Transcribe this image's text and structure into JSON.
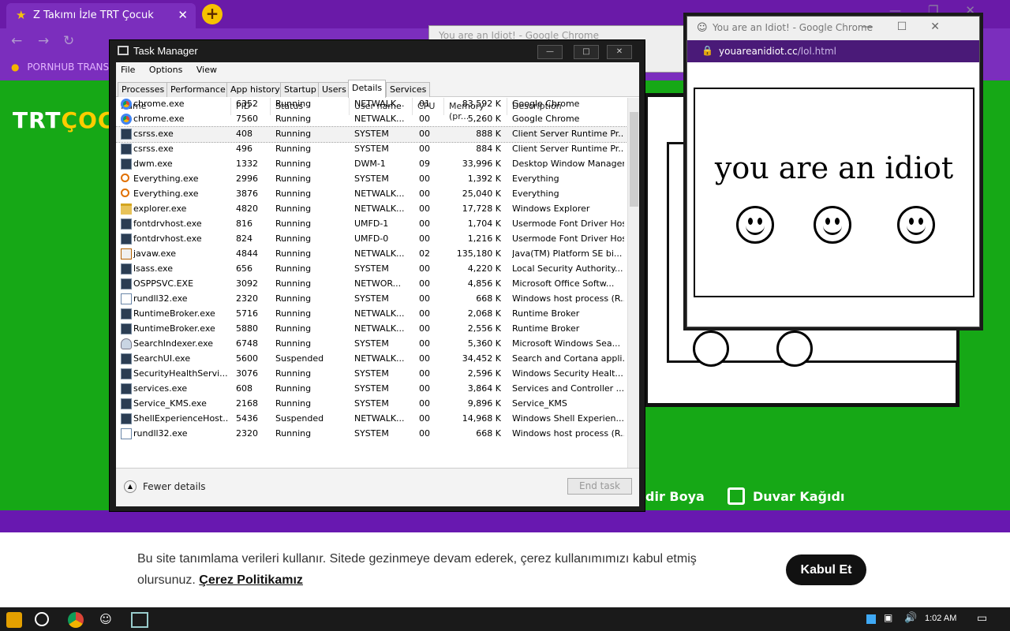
{
  "browser": {
    "tab_title": "Z Takımı İzle TRT Çocuk",
    "bookmark": "PORNHUB TRANS"
  },
  "site": {
    "logo_a": "TRT",
    "logo_b": "ÇOCU",
    "nav_boya": "dir Boya",
    "nav_duvar": "Duvar Kağıdı",
    "cookie_text": "Bu site tanımlama verileri kullanır. Sitede gezinmeye devam ederek, çerez kullanımımızı kabul etmiş olursunuz.",
    "cookie_link": "Çerez Politikamız",
    "accept_label": "Kabul Et"
  },
  "idiot": {
    "window_title": "You are an Idiot! - Google Chrome",
    "url_host": "youareanidiot.cc",
    "url_path": "/lol.html",
    "heading": "you are an idiot"
  },
  "taskmanager": {
    "title": "Task Manager",
    "menu": [
      "File",
      "Options",
      "View"
    ],
    "tabs": [
      "Processes",
      "Performance",
      "App history",
      "Startup",
      "Users",
      "Details",
      "Services"
    ],
    "active_tab": "Details",
    "columns": [
      "Name",
      "PID",
      "Status",
      "User name",
      "CPU",
      "Memory (pr...",
      "Description"
    ],
    "rows": [
      {
        "icon": "chrome",
        "name": "chrome.exe",
        "pid": "6352",
        "status": "Running",
        "user": "NETWALK...",
        "cpu": "01",
        "mem": "83,592 K",
        "desc": "Google Chrome"
      },
      {
        "icon": "chrome",
        "name": "chrome.exe",
        "pid": "7560",
        "status": "Running",
        "user": "NETWALK...",
        "cpu": "00",
        "mem": "5,260 K",
        "desc": "Google Chrome"
      },
      {
        "icon": "win",
        "name": "csrss.exe",
        "pid": "408",
        "status": "Running",
        "user": "SYSTEM",
        "cpu": "00",
        "mem": "888 K",
        "desc": "Client Server Runtime Pr..."
      },
      {
        "icon": "win",
        "name": "csrss.exe",
        "pid": "496",
        "status": "Running",
        "user": "SYSTEM",
        "cpu": "00",
        "mem": "884 K",
        "desc": "Client Server Runtime Pr..."
      },
      {
        "icon": "win",
        "name": "dwm.exe",
        "pid": "1332",
        "status": "Running",
        "user": "DWM-1",
        "cpu": "09",
        "mem": "33,996 K",
        "desc": "Desktop Window Manager"
      },
      {
        "icon": "search",
        "name": "Everything.exe",
        "pid": "2996",
        "status": "Running",
        "user": "SYSTEM",
        "cpu": "00",
        "mem": "1,392 K",
        "desc": "Everything"
      },
      {
        "icon": "search",
        "name": "Everything.exe",
        "pid": "3876",
        "status": "Running",
        "user": "NETWALK...",
        "cpu": "00",
        "mem": "25,040 K",
        "desc": "Everything"
      },
      {
        "icon": "folder",
        "name": "explorer.exe",
        "pid": "4820",
        "status": "Running",
        "user": "NETWALK...",
        "cpu": "00",
        "mem": "17,728 K",
        "desc": "Windows Explorer"
      },
      {
        "icon": "win",
        "name": "fontdrvhost.exe",
        "pid": "816",
        "status": "Running",
        "user": "UMFD-1",
        "cpu": "00",
        "mem": "1,704 K",
        "desc": "Usermode Font Driver Host"
      },
      {
        "icon": "win",
        "name": "fontdrvhost.exe",
        "pid": "824",
        "status": "Running",
        "user": "UMFD-0",
        "cpu": "00",
        "mem": "1,216 K",
        "desc": "Usermode Font Driver Host"
      },
      {
        "icon": "java",
        "name": "javaw.exe",
        "pid": "4844",
        "status": "Running",
        "user": "NETWALK...",
        "cpu": "02",
        "mem": "135,180 K",
        "desc": "Java(TM) Platform SE bi..."
      },
      {
        "icon": "win",
        "name": "lsass.exe",
        "pid": "656",
        "status": "Running",
        "user": "SYSTEM",
        "cpu": "00",
        "mem": "4,220 K",
        "desc": "Local Security Authority..."
      },
      {
        "icon": "win",
        "name": "OSPPSVC.EXE",
        "pid": "3092",
        "status": "Running",
        "user": "NETWOR...",
        "cpu": "00",
        "mem": "4,856 K",
        "desc": "Microsoft Office Softw..."
      },
      {
        "icon": "doc",
        "name": "rundll32.exe",
        "pid": "2320",
        "status": "Running",
        "user": "SYSTEM",
        "cpu": "00",
        "mem": "668 K",
        "desc": "Windows host process (R..."
      },
      {
        "icon": "win",
        "name": "RuntimeBroker.exe",
        "pid": "5716",
        "status": "Running",
        "user": "NETWALK...",
        "cpu": "00",
        "mem": "2,068 K",
        "desc": "Runtime Broker"
      },
      {
        "icon": "win",
        "name": "RuntimeBroker.exe",
        "pid": "5880",
        "status": "Running",
        "user": "NETWALK...",
        "cpu": "00",
        "mem": "2,556 K",
        "desc": "Runtime Broker"
      },
      {
        "icon": "user",
        "name": "SearchIndexer.exe",
        "pid": "6748",
        "status": "Running",
        "user": "SYSTEM",
        "cpu": "00",
        "mem": "5,360 K",
        "desc": "Microsoft Windows Sea..."
      },
      {
        "icon": "win",
        "name": "SearchUI.exe",
        "pid": "5600",
        "status": "Suspended",
        "user": "NETWALK...",
        "cpu": "00",
        "mem": "34,452 K",
        "desc": "Search and Cortana appli..."
      },
      {
        "icon": "win",
        "name": "SecurityHealthServi...",
        "pid": "3076",
        "status": "Running",
        "user": "SYSTEM",
        "cpu": "00",
        "mem": "2,596 K",
        "desc": "Windows Security Healt..."
      },
      {
        "icon": "win",
        "name": "services.exe",
        "pid": "608",
        "status": "Running",
        "user": "SYSTEM",
        "cpu": "00",
        "mem": "3,864 K",
        "desc": "Services and Controller ..."
      },
      {
        "icon": "win",
        "name": "Service_KMS.exe",
        "pid": "2168",
        "status": "Running",
        "user": "SYSTEM",
        "cpu": "00",
        "mem": "9,896 K",
        "desc": "Service_KMS"
      },
      {
        "icon": "win",
        "name": "ShellExperienceHost...",
        "pid": "5436",
        "status": "Suspended",
        "user": "NETWALK...",
        "cpu": "00",
        "mem": "14,968 K",
        "desc": "Windows Shell Experien..."
      },
      {
        "icon": "doc",
        "name": "rundll32.exe",
        "pid": "2320",
        "status": "Running",
        "user": "SYSTEM",
        "cpu": "00",
        "mem": "668 K",
        "desc": "Windows host process (R..."
      }
    ],
    "selected_row": 2,
    "fewer_details": "Fewer details",
    "end_task": "End task"
  },
  "taskbar": {
    "time": "1:02 AM"
  }
}
